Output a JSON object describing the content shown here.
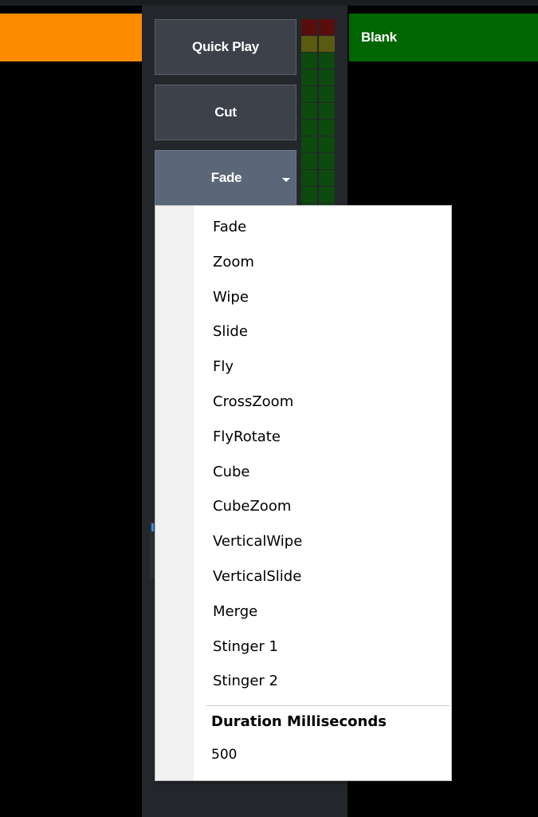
{
  "colors": {
    "orange_bar": "#ff8c00",
    "blank_bar": "#006600",
    "vu_red": "#5a0d0d",
    "vu_yellow": "#5a5a10",
    "vu_green": "#0d4a0d"
  },
  "controls": {
    "quick_play_label": "Quick Play",
    "cut_label": "Cut",
    "transition_selected": "Fade"
  },
  "output": {
    "blank_label": "Blank"
  },
  "transition_menu": {
    "items": [
      "Fade",
      "Zoom",
      "Wipe",
      "Slide",
      "Fly",
      "CrossZoom",
      "FlyRotate",
      "Cube",
      "CubeZoom",
      "VerticalWipe",
      "VerticalSlide",
      "Merge",
      "Stinger 1",
      "Stinger 2"
    ],
    "duration_label": "Duration Milliseconds",
    "duration_value": "500"
  }
}
